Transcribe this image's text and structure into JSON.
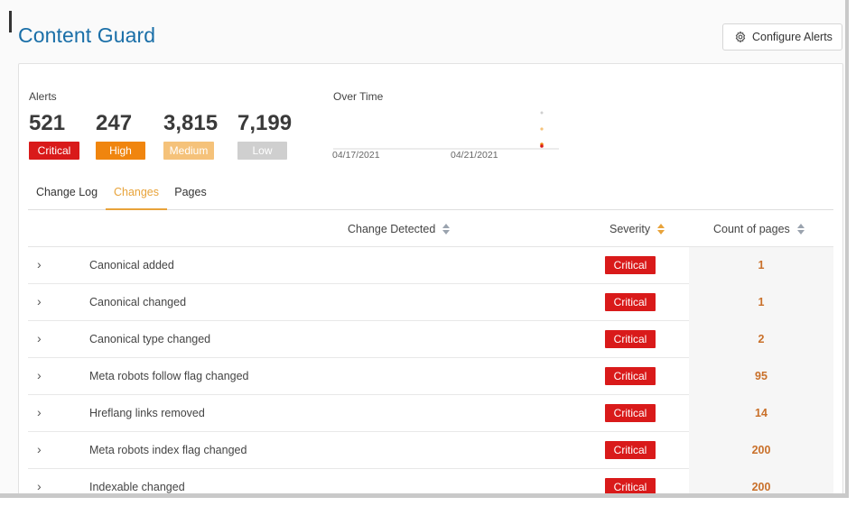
{
  "page": {
    "title": "Content Guard"
  },
  "toolbar": {
    "configure_label": "Configure Alerts",
    "configure_icon": "gear-icon"
  },
  "alerts": {
    "label": "Alerts",
    "stats": [
      {
        "value": "521",
        "badge": "Critical",
        "color": "#d91a1a"
      },
      {
        "value": "247",
        "badge": "High",
        "color": "#f0850e"
      },
      {
        "value": "3,815",
        "badge": "Medium",
        "color": "#f5c27a"
      },
      {
        "value": "7,199",
        "badge": "Low",
        "color": "#cfcfcf"
      }
    ]
  },
  "over_time": {
    "label": "Over Time",
    "dates": [
      "04/17/2021",
      "04/21/2021"
    ]
  },
  "tabs": [
    {
      "label": "Change Log",
      "active": false
    },
    {
      "label": "Changes",
      "active": true
    },
    {
      "label": "Pages",
      "active": false
    }
  ],
  "table": {
    "columns": {
      "change": "Change Detected",
      "severity": "Severity",
      "count": "Count of pages"
    },
    "rows": [
      {
        "change": "Canonical added",
        "severity": "Critical",
        "count": "1"
      },
      {
        "change": "Canonical changed",
        "severity": "Critical",
        "count": "1"
      },
      {
        "change": "Canonical type changed",
        "severity": "Critical",
        "count": "2"
      },
      {
        "change": "Meta robots follow flag changed",
        "severity": "Critical",
        "count": "95"
      },
      {
        "change": "Hreflang links removed",
        "severity": "Critical",
        "count": "14"
      },
      {
        "change": "Meta robots index flag changed",
        "severity": "Critical",
        "count": "200"
      },
      {
        "change": "Indexable changed",
        "severity": "Critical",
        "count": "200"
      }
    ]
  }
}
